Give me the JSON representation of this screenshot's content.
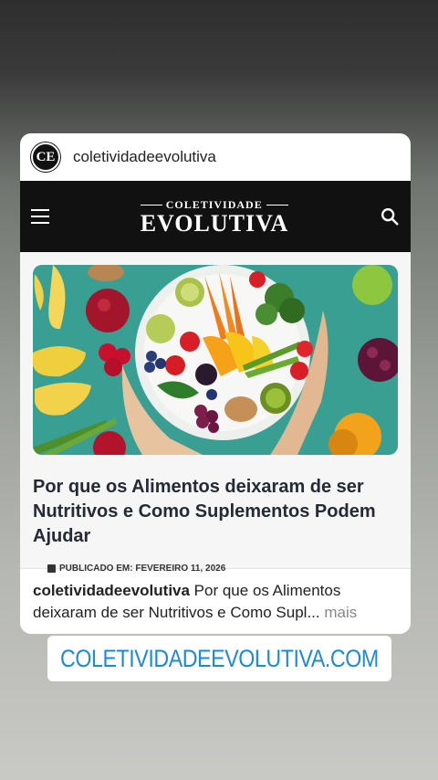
{
  "post": {
    "avatar_initials": "CE",
    "username": "coletividadeevolutiva"
  },
  "site": {
    "logo_top": "COLETIVIDADE",
    "logo_main": "EVOLUTIVA"
  },
  "article": {
    "title": "Por que os Alimentos deixaram de ser Nutritivos e Como Suplementos Podem Ajudar",
    "meta": "PUBLICADO EM: FEVEREIRO 11, 2026",
    "image_alt": "hands holding a plate of colorful vegetables and fruits"
  },
  "caption": {
    "username": "coletividadeevolutiva",
    "text": " Por que os Alimentos deixaram de ser Nutritivos e Como Supl...",
    "more": " mais"
  },
  "link_sticker": {
    "icon": "link-icon",
    "text": "COLETIVIDADEEVOLUTIVA.COM",
    "color": "#1d8ad8"
  }
}
